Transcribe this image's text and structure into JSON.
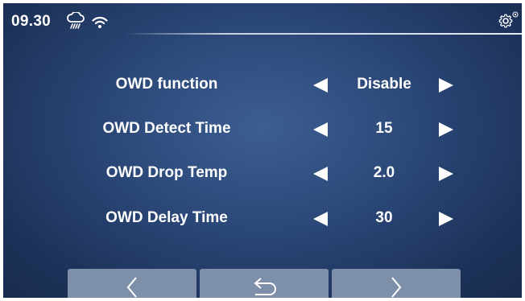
{
  "status": {
    "time": "09.30",
    "weather_icon": "cloud-drizzle-icon",
    "wifi_icon": "wifi-icon",
    "settings_icon": "gear-icon"
  },
  "settings_rows": [
    {
      "label": "OWD function",
      "value": "Disable"
    },
    {
      "label": "OWD Detect Time",
      "value": "15"
    },
    {
      "label": "OWD Drop Temp",
      "value": "2.0"
    },
    {
      "label": "OWD Delay Time",
      "value": "30"
    }
  ],
  "nav": {
    "prev_icon": "chevron-left-icon",
    "back_icon": "return-arrow-icon",
    "next_icon": "chevron-right-icon"
  },
  "colors": {
    "background": "#2a4676",
    "text": "#ffffff",
    "nav_button": "#7e8fa9"
  }
}
